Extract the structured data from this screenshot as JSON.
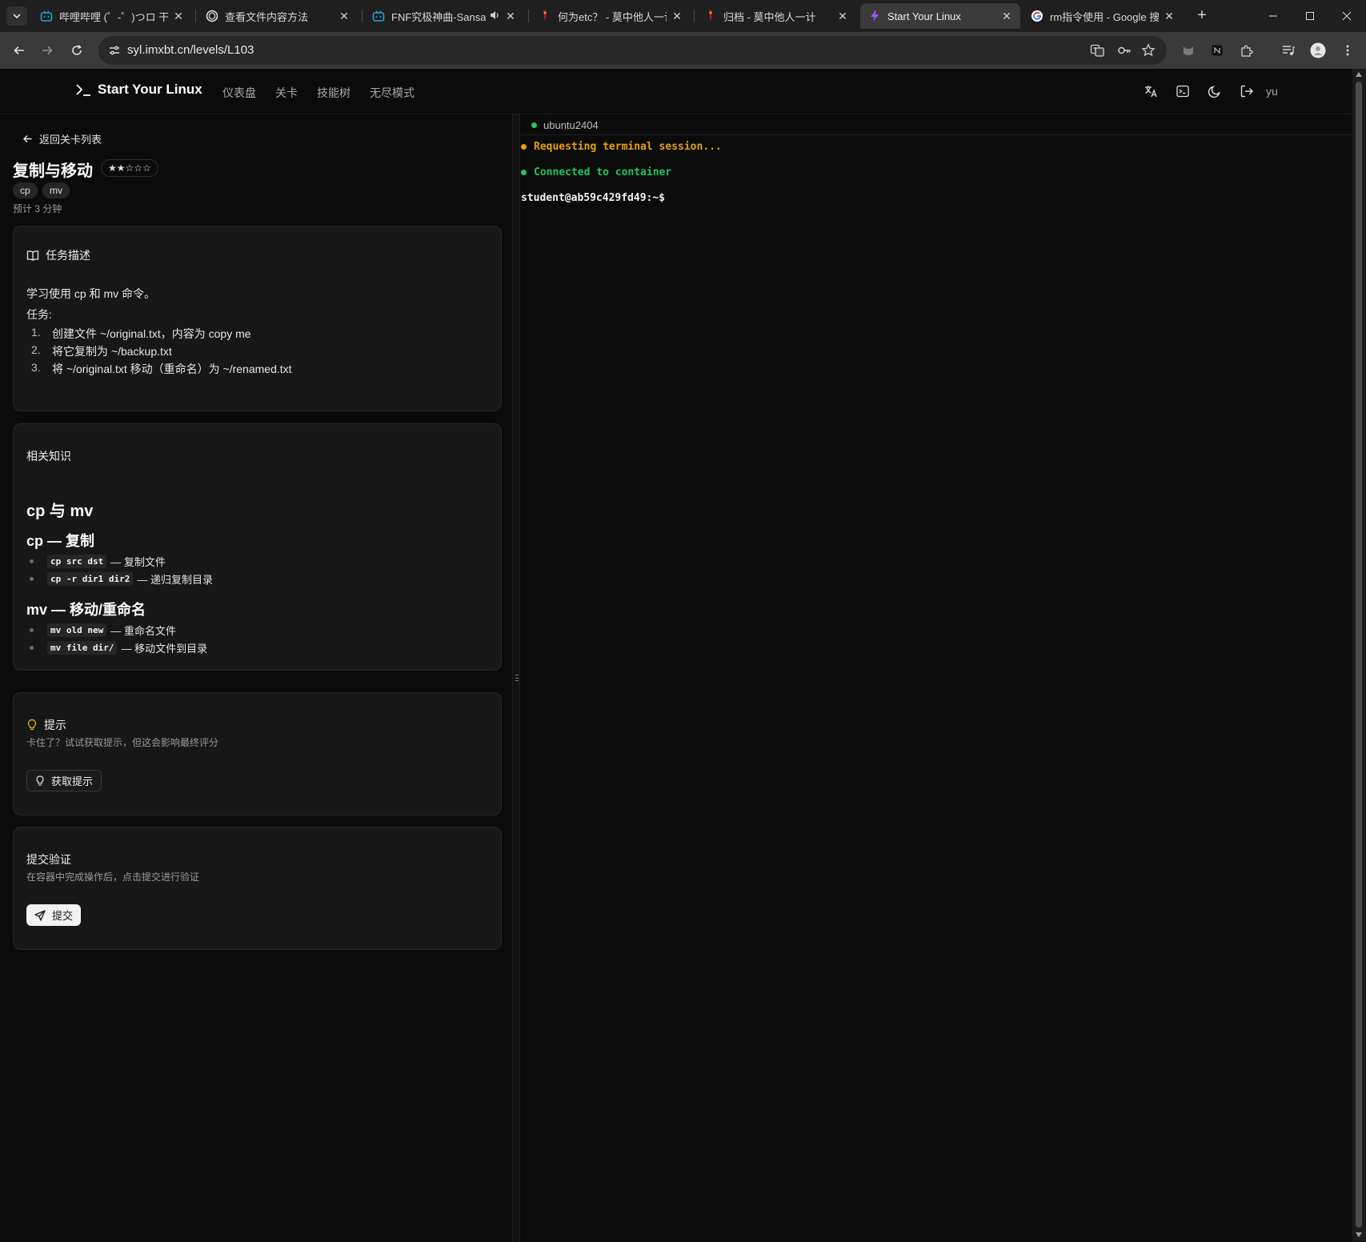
{
  "browser": {
    "tabs": [
      {
        "title": "哔哩哔哩 (゜-゜)つロ 干杯",
        "favicon": "bilibili-icon",
        "active": false
      },
      {
        "title": "查看文件内容方法",
        "favicon": "chatgpt-icon",
        "active": false
      },
      {
        "title": "FNF究极神曲-Sansati",
        "favicon": "bilibili-icon",
        "audio": true,
        "active": false
      },
      {
        "title": "何为etc？ - 莫中他人一计",
        "favicon": "red-bookmark-icon",
        "active": false
      },
      {
        "title": "归档 - 莫中他人一计",
        "favicon": "red-bookmark-icon",
        "active": false
      },
      {
        "title": "Start Your Linux",
        "favicon": "lightning-icon",
        "active": true
      },
      {
        "title": "rm指令使用 - Google 搜索",
        "favicon": "google-icon",
        "active": false
      }
    ],
    "url": "syl.imxbt.cn/levels/L103",
    "tab_close_glyph": "✕",
    "new_tab_glyph": "+"
  },
  "header": {
    "brand": "Start Your Linux",
    "nav": [
      "仪表盘",
      "关卡",
      "技能树",
      "无尽模式"
    ],
    "user": "yu"
  },
  "level": {
    "back_label": "返回关卡列表",
    "title": "复制与移动",
    "stars": "★★☆☆☆",
    "tags": [
      "cp",
      "mv"
    ],
    "estimate": "预计 3 分钟"
  },
  "task": {
    "heading": "任务描述",
    "intro": "学习使用 cp 和 mv 命令。",
    "tasks_label": "任务:",
    "items": [
      {
        "num": "1.",
        "text": "创建文件 ~/original.txt，内容为 copy me"
      },
      {
        "num": "2.",
        "text": "将它复制为 ~/backup.txt"
      },
      {
        "num": "3.",
        "text": "将 ~/original.txt 移动（重命名）为 ~/renamed.txt"
      }
    ]
  },
  "knowledge": {
    "heading": "相关知识",
    "h1": "cp 与 mv",
    "cp_heading": "cp — 复制",
    "cp_items": [
      {
        "code": "cp src dst",
        "desc": "— 复制文件"
      },
      {
        "code": "cp -r dir1 dir2",
        "desc": "— 递归复制目录"
      }
    ],
    "mv_heading": "mv — 移动/重命名",
    "mv_items": [
      {
        "code": "mv old new",
        "desc": "— 重命名文件"
      },
      {
        "code": "mv file dir/",
        "desc": "— 移动文件到目录"
      }
    ]
  },
  "hint": {
    "heading": "提示",
    "desc": "卡住了？试试获取提示，但这会影响最终评分",
    "button": "获取提示"
  },
  "submit": {
    "heading": "提交验证",
    "desc": "在容器中完成操作后，点击提交进行验证",
    "button": "提交"
  },
  "terminal": {
    "container": "ubuntu2404",
    "lines": [
      {
        "text": "Requesting terminal session...",
        "color": "#e5a00d",
        "bullet": true
      },
      {
        "text": "Connected to container",
        "color": "#22c55e",
        "bullet": true
      },
      {
        "text": "student@ab59c429fd49:~$",
        "color": "#f2f2f2",
        "bullet": false
      }
    ]
  },
  "colors": {
    "accent_green": "#22c55e",
    "accent_amber": "#e5a00d",
    "hint_icon": "#eab308"
  }
}
